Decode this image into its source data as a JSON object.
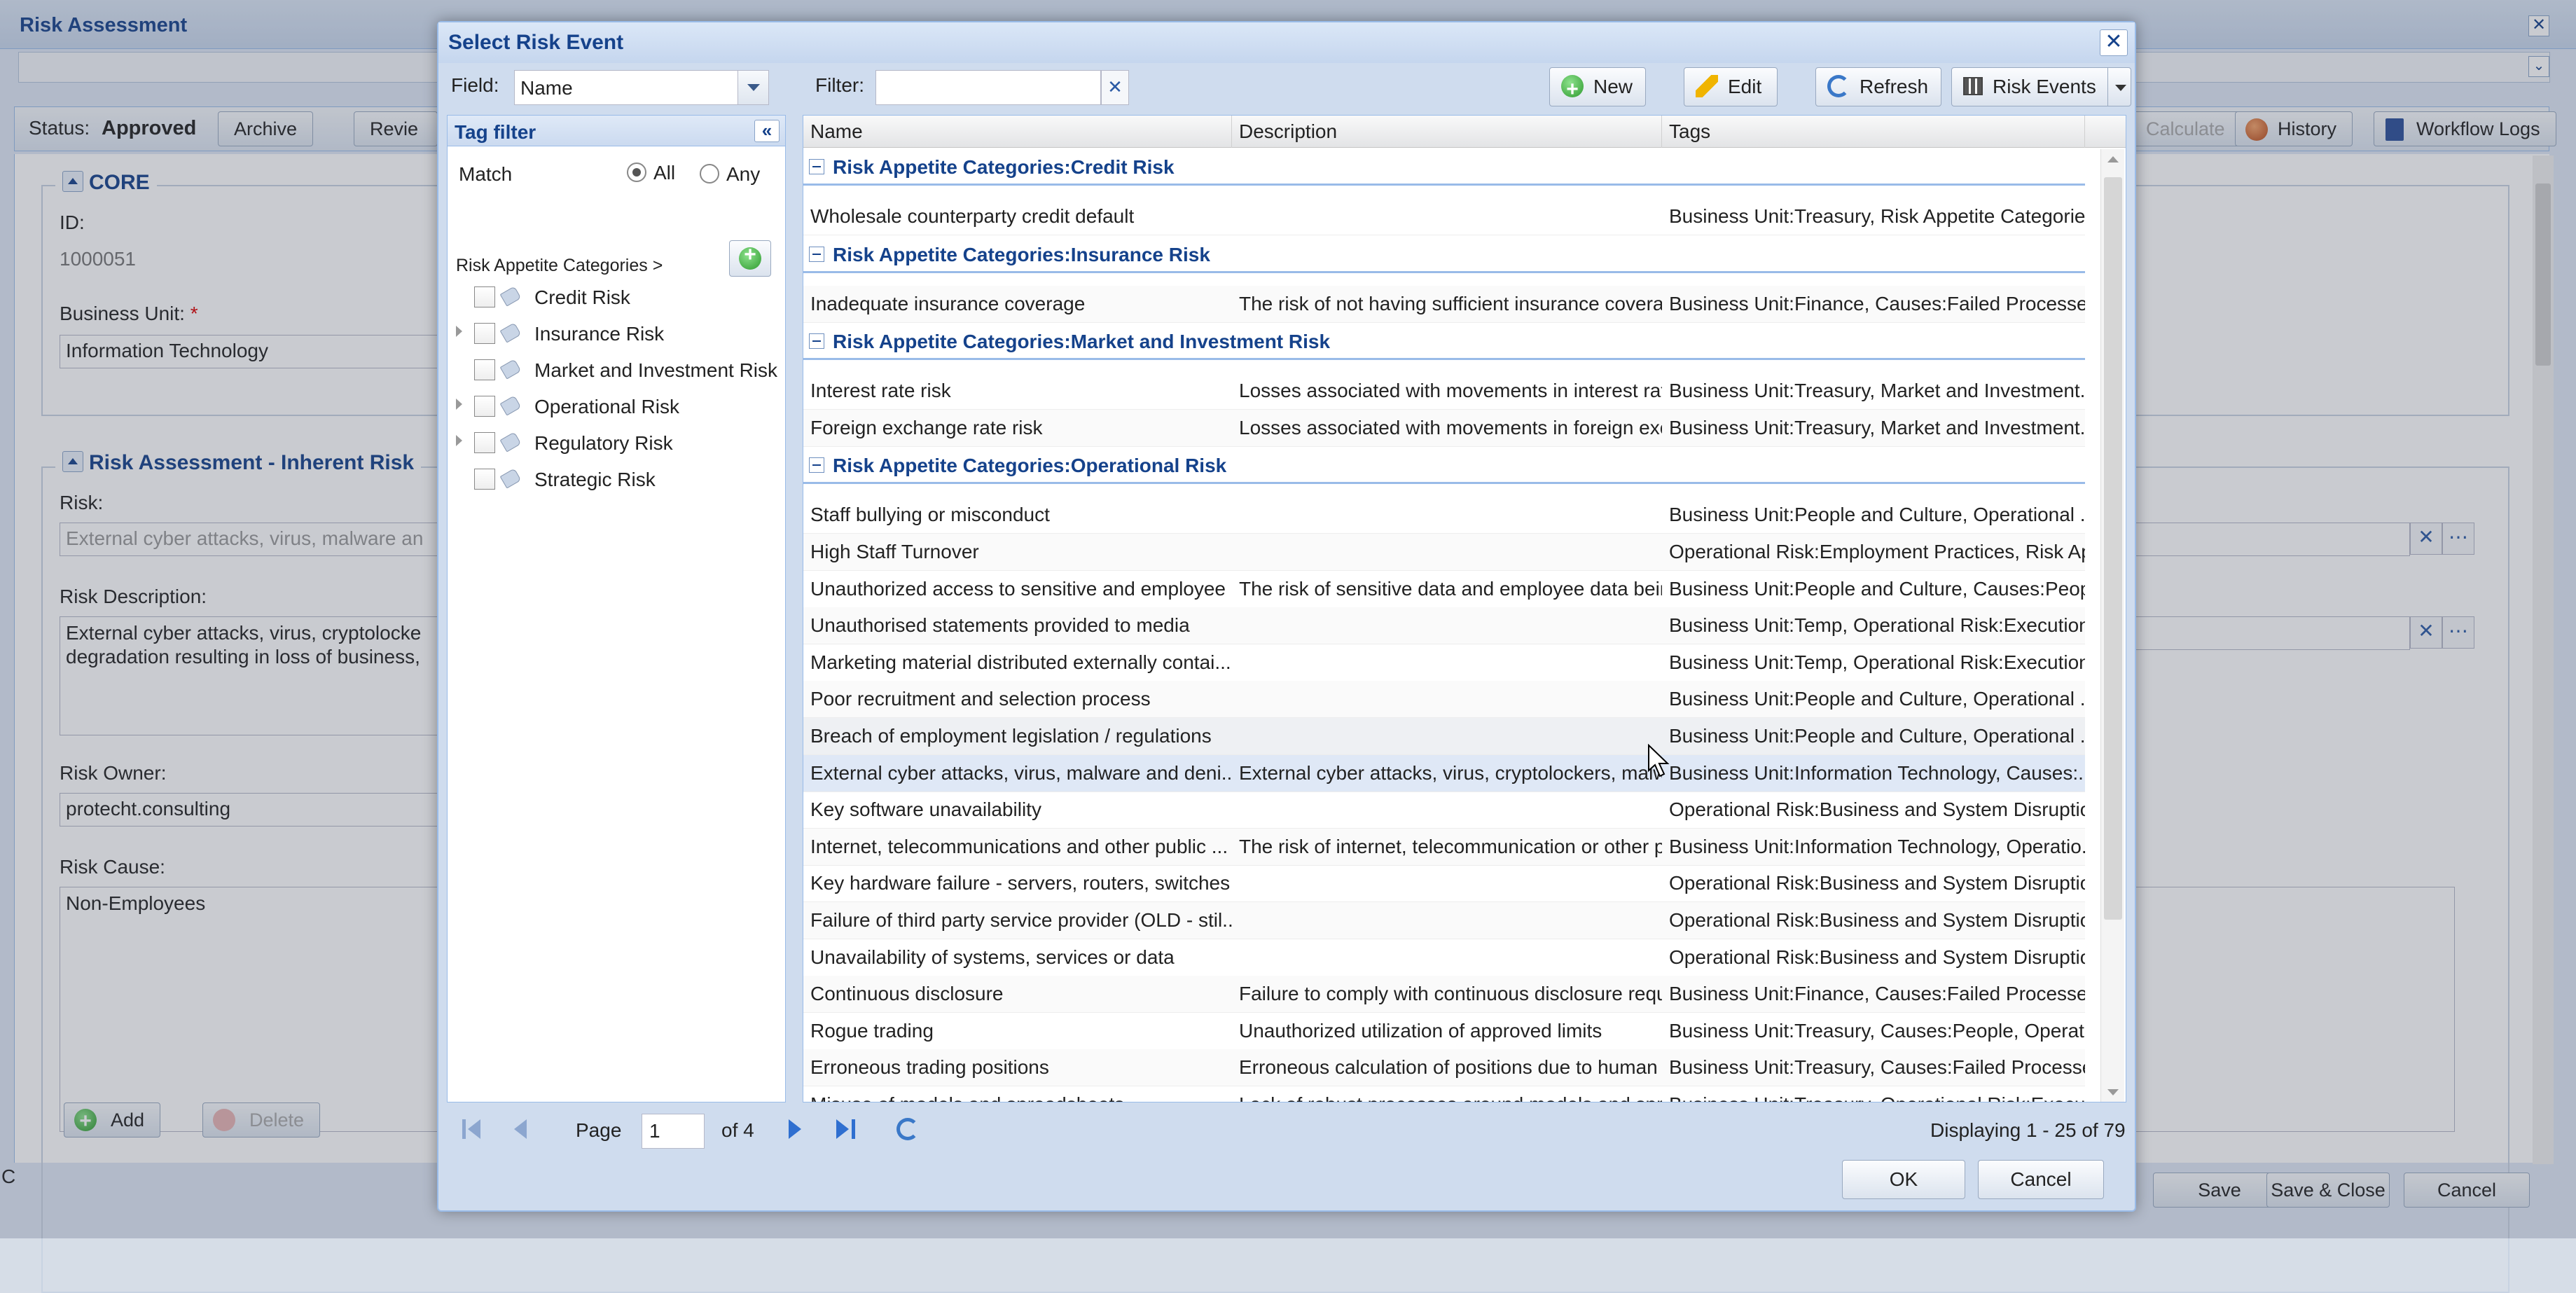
{
  "background": {
    "window_title": "Risk Assessment",
    "status_label": "Status:",
    "status_value": "Approved",
    "toolbar": {
      "archive": "Archive",
      "review": "Revie",
      "calculate": "Calculate",
      "history": "History",
      "workflow_logs": "Workflow Logs"
    },
    "core_section": {
      "title": "CORE",
      "id_label": "ID:",
      "id_value": "1000051",
      "business_unit_label": "Business Unit:",
      "business_unit_value": "Information Technology"
    },
    "inherent_section": {
      "title": "Risk Assessment - Inherent Risk",
      "risk_label": "Risk:",
      "risk_value": "External cyber attacks, virus, malware an",
      "risk_description_label": "Risk Description:",
      "risk_description_line1": "External cyber attacks, virus, cryptolocke",
      "risk_description_line2": "degradation resulting in loss of business,",
      "risk_owner_label": "Risk Owner:",
      "risk_owner_value": "protecht.consulting",
      "risk_cause_label": "Risk Cause:",
      "risk_cause_value": "Non-Employees",
      "add_button": "Add",
      "delete_button": "Delete"
    },
    "footer": {
      "save": "Save",
      "save_close": "Save & Close",
      "cancel": "Cancel"
    },
    "left_edge_text": "C"
  },
  "dialog": {
    "title": "Select Risk Event",
    "field_label": "Field:",
    "field_value": "Name",
    "filter_label": "Filter:",
    "filter_value": "",
    "buttons": {
      "new": "New",
      "edit": "Edit",
      "refresh": "Refresh",
      "risk_events": "Risk Events"
    },
    "tag_filter": {
      "title": "Tag filter",
      "match_label": "Match",
      "match_all": "All",
      "match_any": "Any",
      "selected_match": "All",
      "breadcrumb": "Risk Appetite Categories >",
      "nodes": [
        {
          "label": "Credit Risk",
          "expandable": false
        },
        {
          "label": "Insurance Risk",
          "expandable": true
        },
        {
          "label": "Market and Investment Risk",
          "expandable": false
        },
        {
          "label": "Operational Risk",
          "expandable": true
        },
        {
          "label": "Regulatory Risk",
          "expandable": true
        },
        {
          "label": "Strategic Risk",
          "expandable": false
        }
      ]
    },
    "grid": {
      "columns": [
        "Name",
        "Description",
        "Tags"
      ],
      "groups": [
        {
          "title": "Risk Appetite Categories:Credit Risk",
          "rows": [
            [
              "Wholesale counterparty credit default",
              "",
              "Business Unit:Treasury, Risk Appetite Categorie..."
            ]
          ]
        },
        {
          "title": "Risk Appetite Categories:Insurance Risk",
          "rows": [
            [
              "Inadequate insurance coverage",
              "The risk of not having sufficient insurance coverage",
              "Business Unit:Finance, Causes:Failed Processes..."
            ]
          ]
        },
        {
          "title": "Risk Appetite Categories:Market and Investment Risk",
          "rows": [
            [
              "Interest rate risk",
              "Losses associated with movements in interest rates",
              "Business Unit:Treasury, Market and Investment..."
            ],
            [
              "Foreign exchange rate risk",
              "Losses associated with movements in foreign exchange",
              "Business Unit:Treasury, Market and Investment..."
            ]
          ]
        },
        {
          "title": "Risk Appetite Categories:Operational Risk",
          "rows": [
            [
              "Staff bullying or misconduct",
              "",
              "Business Unit:People and Culture, Operational ..."
            ],
            [
              "High Staff Turnover",
              "",
              "Operational Risk:Employment Practices, Risk Ap..."
            ],
            [
              "Unauthorized access to sensitive and employee ...",
              "The risk of sensitive data and employee data being",
              "Business Unit:People and Culture, Causes:Peopl..."
            ],
            [
              "Unauthorised statements provided to media",
              "",
              "Business Unit:Temp, Operational Risk:Execution..."
            ],
            [
              "Marketing material distributed externally contai...",
              "",
              "Business Unit:Temp, Operational Risk:Execution..."
            ],
            [
              "Poor recruitment and selection process",
              "",
              "Business Unit:People and Culture, Operational ..."
            ],
            [
              "Breach of employment legislation / regulations",
              "",
              "Business Unit:People and Culture, Operational ..."
            ],
            [
              "External cyber attacks, virus, malware and deni...",
              "External cyber attacks, virus, cryptolockers, malware",
              "Business Unit:Information Technology, Causes:..."
            ],
            [
              "Key software unavailability",
              "",
              "Operational Risk:Business and System Disruptio..."
            ],
            [
              "Internet, telecommunications and other public ...",
              "The risk of internet, telecommunication or other pu",
              "Business Unit:Information Technology, Operatio..."
            ],
            [
              "Key hardware failure - servers, routers, switches",
              "",
              "Operational Risk:Business and System Disruptio..."
            ],
            [
              "Failure of third party service provider (OLD - stil...",
              "",
              "Operational Risk:Business and System Disruptio..."
            ],
            [
              "Unavailability of systems, services or data",
              "",
              "Operational Risk:Business and System Disruptio..."
            ],
            [
              "Continuous disclosure",
              "Failure to comply with continuous disclosure requir",
              "Business Unit:Finance, Causes:Failed Processes..."
            ],
            [
              "Rogue trading",
              "Unauthorized utilization of approved limits",
              "Business Unit:Treasury, Causes:People, Operati..."
            ],
            [
              "Erroneous trading positions",
              "Erroneous calculation of positions due to human er",
              "Business Unit:Treasury, Causes:Failed Processe..."
            ],
            [
              "Misuse of models and spreadsheets",
              "Lack of robust processes around models and spread",
              "Business Unit:Treasury, Operational Risk:Execu..."
            ]
          ]
        }
      ]
    },
    "paging": {
      "page_label": "Page",
      "page_value": "1",
      "of_label": "of 4",
      "displaying": "Displaying 1 - 25 of 79"
    },
    "ok": "OK",
    "cancel": "Cancel"
  }
}
